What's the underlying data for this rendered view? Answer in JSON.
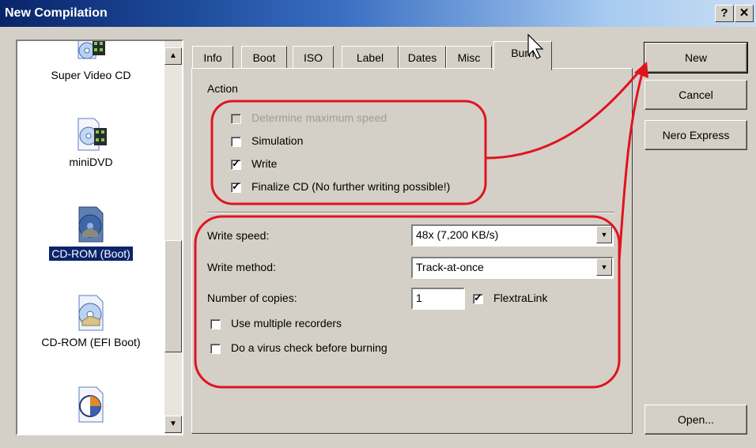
{
  "window": {
    "title": "New Compilation",
    "help_label": "?",
    "close_label": "✕"
  },
  "compilation_list": {
    "items": [
      {
        "label": "Super Video CD",
        "icon": "super-video-cd-icon",
        "selected": false
      },
      {
        "label": "miniDVD",
        "icon": "minidvd-icon",
        "selected": false
      },
      {
        "label": "CD-ROM (Boot)",
        "icon": "cd-rom-boot-icon",
        "selected": true
      },
      {
        "label": "CD-ROM (EFI Boot)",
        "icon": "cd-rom-efi-boot-icon",
        "selected": false
      },
      {
        "label": "",
        "icon": "disc-document-icon",
        "selected": false
      }
    ]
  },
  "tabs": [
    {
      "label": "Info",
      "active": false
    },
    {
      "label": "Boot",
      "active": false
    },
    {
      "label": "ISO",
      "active": false
    },
    {
      "label": "Label",
      "active": false
    },
    {
      "label": "Dates",
      "active": false
    },
    {
      "label": "Misc",
      "active": false
    },
    {
      "label": "Burn",
      "active": true
    }
  ],
  "burn": {
    "action_heading": "Action",
    "determine_max_speed": {
      "label": "Determine maximum speed",
      "checked": false,
      "enabled": false
    },
    "simulation": {
      "label": "Simulation",
      "checked": false
    },
    "write": {
      "label": "Write",
      "checked": true
    },
    "finalize": {
      "label": "Finalize CD (No further writing possible!)",
      "checked": true
    },
    "write_speed": {
      "label": "Write speed:",
      "value": "48x (7,200 KB/s)"
    },
    "write_method": {
      "label": "Write method:",
      "value": "Track-at-once"
    },
    "copies": {
      "label": "Number of copies:",
      "value": "1"
    },
    "flextralink": {
      "label": "FlextraLink",
      "checked": true
    },
    "multiple_recorders": {
      "label": "Use multiple recorders",
      "checked": false
    },
    "virus_check": {
      "label": "Do a virus check before burning",
      "checked": false
    }
  },
  "buttons": {
    "new": "New",
    "cancel": "Cancel",
    "nero_express": "Nero Express",
    "open": "Open..."
  },
  "colors": {
    "annotation": "#e0141e",
    "selection": "#0a246a"
  }
}
